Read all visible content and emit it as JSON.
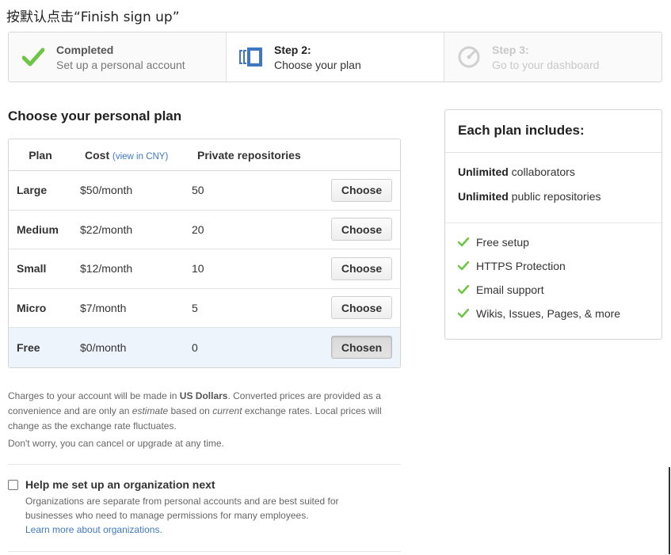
{
  "caption": "按默认点击“Finish sign up”",
  "steps": [
    {
      "title": "Completed",
      "subtitle": "Set up a personal account",
      "icon": "check-icon",
      "state": "completed"
    },
    {
      "title": "Step 2:",
      "subtitle": "Choose your plan",
      "icon": "plan-select-icon",
      "state": "current"
    },
    {
      "title": "Step 3:",
      "subtitle": "Go to your dashboard",
      "icon": "dashboard-gauge-icon",
      "state": "upcoming"
    }
  ],
  "plan_section": {
    "heading": "Choose your personal plan",
    "columns": {
      "plan": "Plan",
      "cost": "Cost",
      "cost_link": "(view in CNY)",
      "private": "Private repositories"
    },
    "rows": [
      {
        "name": "Large",
        "cost": "$50/month",
        "private": "50",
        "button": "Choose"
      },
      {
        "name": "Medium",
        "cost": "$22/month",
        "private": "20",
        "button": "Choose"
      },
      {
        "name": "Small",
        "cost": "$12/month",
        "private": "10",
        "button": "Choose"
      },
      {
        "name": "Micro",
        "cost": "$7/month",
        "private": "5",
        "button": "Choose"
      },
      {
        "name": "Free",
        "cost": "$0/month",
        "private": "0",
        "button": "Chosen"
      }
    ]
  },
  "includes": {
    "heading": "Each plan includes:",
    "unlimited": [
      {
        "bold": "Unlimited",
        "rest": " collaborators"
      },
      {
        "bold": "Unlimited",
        "rest": " public repositories"
      }
    ],
    "features": [
      "Free setup",
      "HTTPS Protection",
      "Email support",
      "Wikis, Issues, Pages, & more"
    ],
    "check_color": "#6cc644"
  },
  "notes": {
    "n1_a": "Charges to your account will be made in ",
    "n1_b": "US Dollars",
    "n1_c": ". Converted prices are provided as a convenience and are only an ",
    "n1_d": "estimate",
    "n1_e": " based on ",
    "n1_f": "current",
    "n1_g": " exchange rates. Local prices will change as the exchange rate fluctuates.",
    "n2": "Don't worry, you can cancel or upgrade at any time."
  },
  "org": {
    "label": "Help me set up an organization next",
    "description": "Organizations are separate from personal accounts and are best suited for businesses who need to manage permissions for many employees.",
    "link": "Learn more about organizations."
  },
  "colors": {
    "accent_blue": "#4078c0",
    "selected_row": "#eef4fb"
  }
}
